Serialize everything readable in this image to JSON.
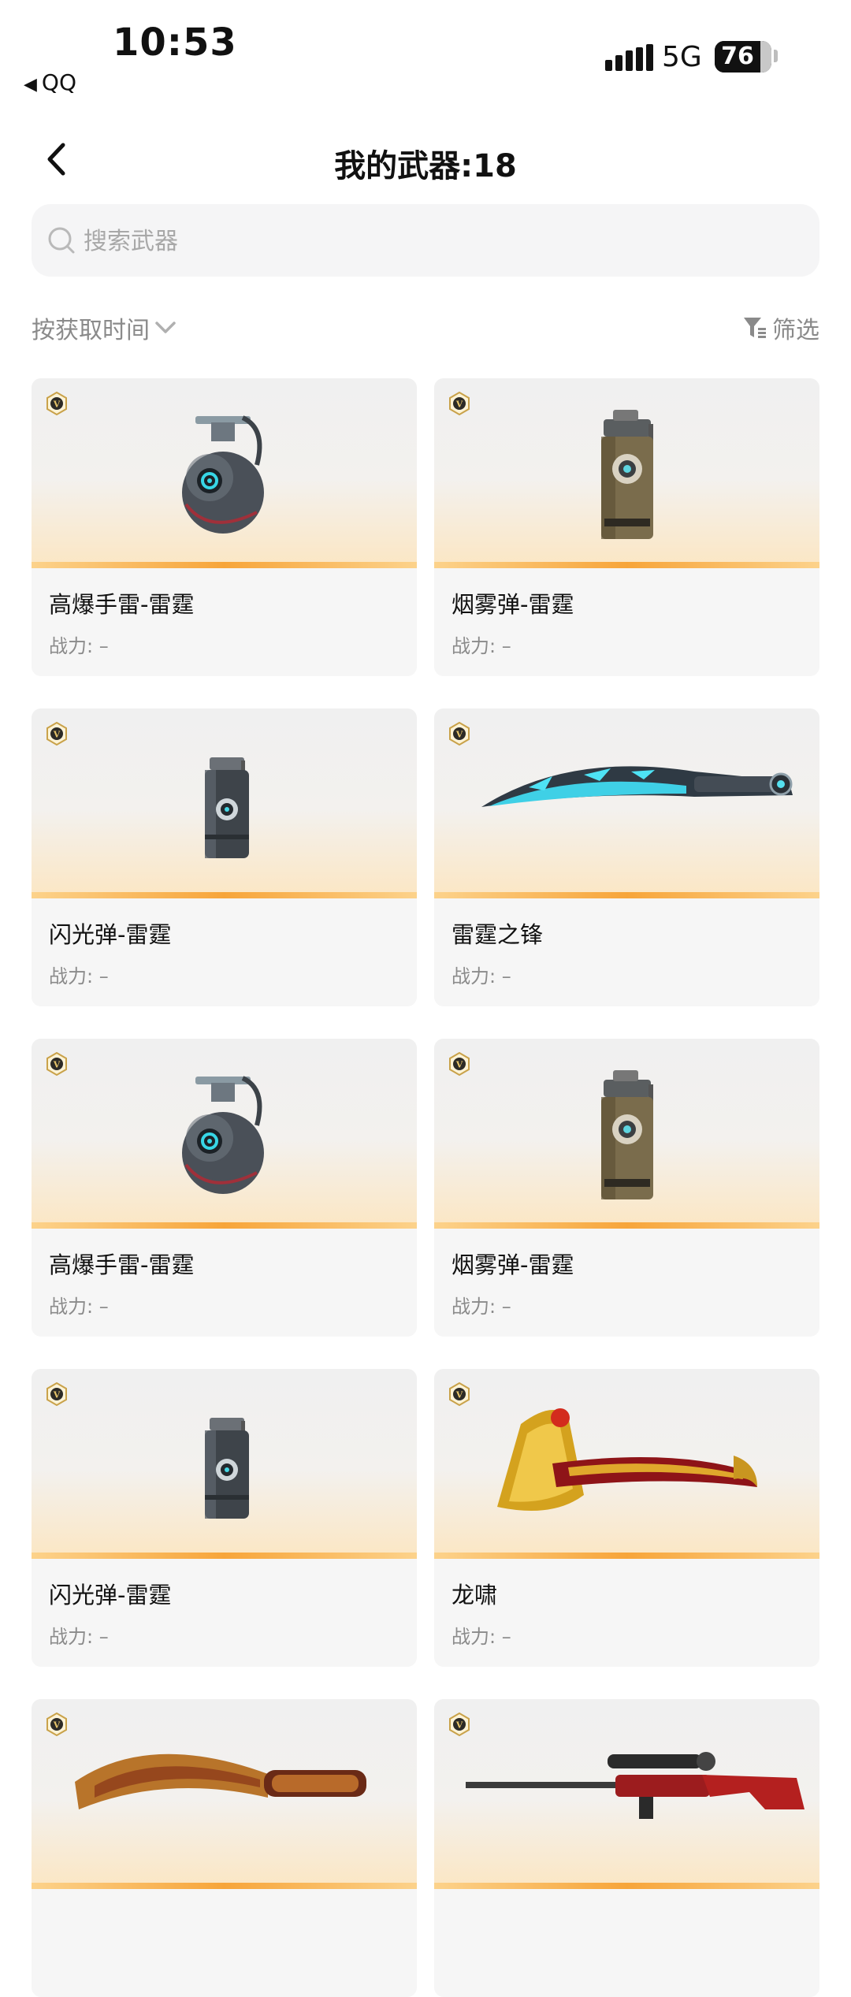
{
  "status_bar": {
    "time": "10:53",
    "back_app": "QQ",
    "network": "5G",
    "battery": "76",
    "battery_level": 0.76
  },
  "header": {
    "title": "我的武器:18"
  },
  "search": {
    "placeholder": "搜索武器",
    "value": ""
  },
  "sort": {
    "label": "按获取时间"
  },
  "filter": {
    "label": "筛选"
  },
  "weapons": [
    {
      "name": "高爆手雷-雷霆",
      "power": "战力: –",
      "icon": "grenade-icon"
    },
    {
      "name": "烟雾弹-雷霆",
      "power": "战力: –",
      "icon": "smoke-grenade-icon"
    },
    {
      "name": "闪光弹-雷霆",
      "power": "战力: –",
      "icon": "flashbang-icon"
    },
    {
      "name": "雷霆之锋",
      "power": "战力: –",
      "icon": "blade-icon"
    },
    {
      "name": "高爆手雷-雷霆",
      "power": "战力: –",
      "icon": "grenade-icon"
    },
    {
      "name": "烟雾弹-雷霆",
      "power": "战力: –",
      "icon": "smoke-grenade-icon"
    },
    {
      "name": "闪光弹-雷霆",
      "power": "战力: –",
      "icon": "flashbang-icon"
    },
    {
      "name": "龙啸",
      "power": "战力: –",
      "icon": "dragon-axe-icon"
    },
    {
      "name": "",
      "power": "",
      "icon": "kukri-knife-icon"
    },
    {
      "name": "",
      "power": "",
      "icon": "sniper-rifle-icon"
    }
  ],
  "colors": {
    "accent_bar": "#f7a53a",
    "badge_gold": "#b58a2d",
    "card_bg": "#f6f6f6",
    "muted_text": "#8b8b8b"
  }
}
